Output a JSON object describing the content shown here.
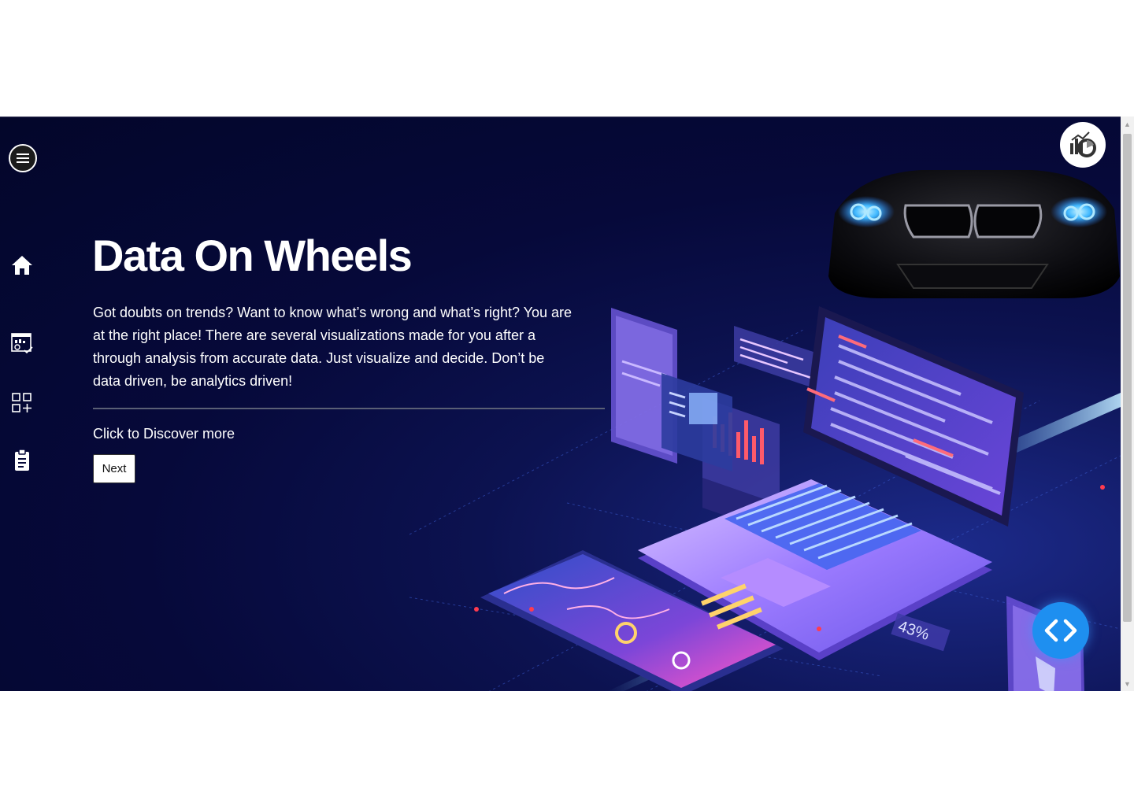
{
  "hero": {
    "title": "Data On Wheels",
    "description": "Got doubts on trends? Want to know what’s wrong and what’s right? You are at the right place! There are several visualizations made for you after a through analysis from accurate data. Just visualize and decide. Don’t be data driven, be analytics driven!",
    "discover_text": "Click to Discover more",
    "next_label": "Next"
  },
  "sidebar": {
    "items": [
      {
        "icon": "home-icon"
      },
      {
        "icon": "dashboard-report-icon"
      },
      {
        "icon": "add-widget-icon"
      },
      {
        "icon": "clipboard-icon"
      }
    ]
  },
  "illustration": {
    "percent_label": "43%"
  },
  "colors": {
    "background": "#06093a",
    "accent": "#1e8ff0",
    "text": "#ffffff"
  }
}
